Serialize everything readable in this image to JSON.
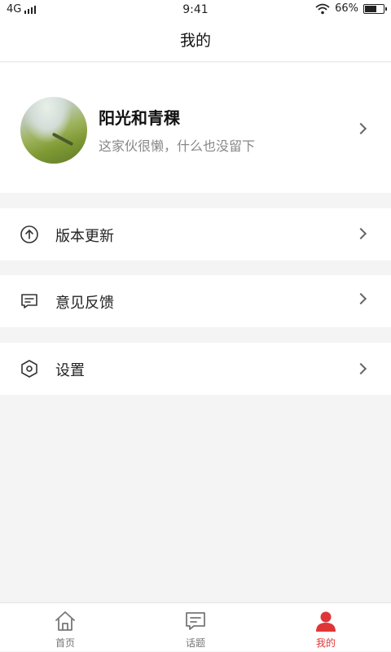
{
  "status_bar": {
    "network": "4G",
    "time": "9:41",
    "battery_percent": "66%",
    "battery_level": 0.66
  },
  "nav": {
    "title": "我的"
  },
  "profile": {
    "name": "阳光和青稞",
    "bio": "这家伙很懒，什么也没留下"
  },
  "menu": [
    {
      "label": "版本更新",
      "icon": "upload-circle-icon"
    },
    {
      "label": "意见反馈",
      "icon": "feedback-icon"
    },
    {
      "label": "设置",
      "icon": "settings-hexagon-icon"
    }
  ],
  "tabs": [
    {
      "label": "首页",
      "icon": "home-icon",
      "active": false
    },
    {
      "label": "话题",
      "icon": "topic-icon",
      "active": false
    },
    {
      "label": "我的",
      "icon": "user-icon",
      "active": true
    }
  ],
  "colors": {
    "accent": "#e03537",
    "background": "#f4f4f4"
  }
}
